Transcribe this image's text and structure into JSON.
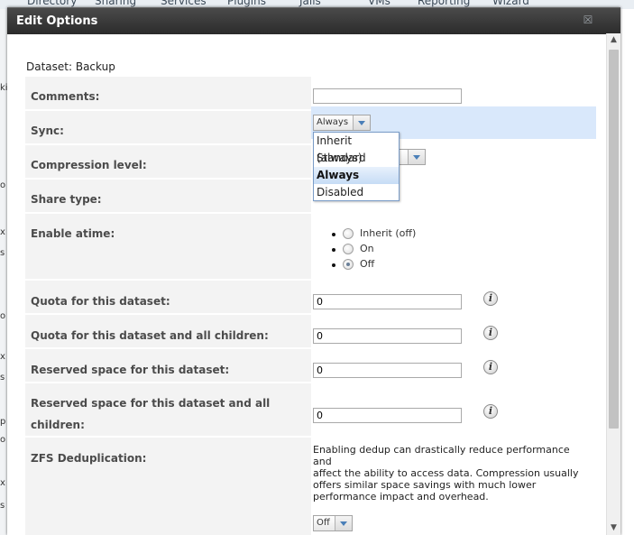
{
  "background_nav": {
    "items": [
      "Directory",
      "Sharing",
      "Services",
      "Plugins",
      "Jails",
      "VMs",
      "Reporting",
      "Wizard"
    ]
  },
  "background_left": {
    "letters": [
      "ki",
      "a",
      "o",
      "x",
      "s",
      "o",
      "x",
      "s",
      "p",
      "o",
      "x",
      "s"
    ]
  },
  "dialog": {
    "title": "Edit Options",
    "close_icon": "close-icon"
  },
  "dataset_label": "Dataset: Backup",
  "fields": {
    "comments": {
      "label": "Comments:",
      "value": ""
    },
    "sync": {
      "label": "Sync:",
      "selected": "Always",
      "options": [
        "Inherit (always)",
        "Standard",
        "Always",
        "Disabled"
      ],
      "highlighted_option": "Always",
      "expanded": true
    },
    "compression": {
      "label": "Compression level:"
    },
    "share_type": {
      "label": "Share type:"
    },
    "atime": {
      "label": "Enable atime:",
      "options": [
        "Inherit (off)",
        "On",
        "Off"
      ],
      "selected": "Off"
    },
    "quota": {
      "label": "Quota for this dataset:",
      "value": "0"
    },
    "quota_children": {
      "label": "Quota for this dataset and all children:",
      "value": "0"
    },
    "reserved": {
      "label": "Reserved space for this dataset:",
      "value": "0"
    },
    "reserved_children": {
      "label_line1": "Reserved space for this dataset and all",
      "label_line2": "children:",
      "value": "0"
    },
    "dedup": {
      "label": "ZFS Deduplication:",
      "description_lines": [
        "Enabling dedup can drastically reduce performance",
        "and",
        "affect the ability to access data. Compression usually",
        "offers similar space savings with much lower",
        "performance impact and overhead."
      ],
      "selected": "Off"
    }
  },
  "info_icon_glyph": "i",
  "colors": {
    "titlebar": "#333333",
    "highlight_row": "#d9e8fb",
    "label_bg": "#f3f3f3"
  }
}
